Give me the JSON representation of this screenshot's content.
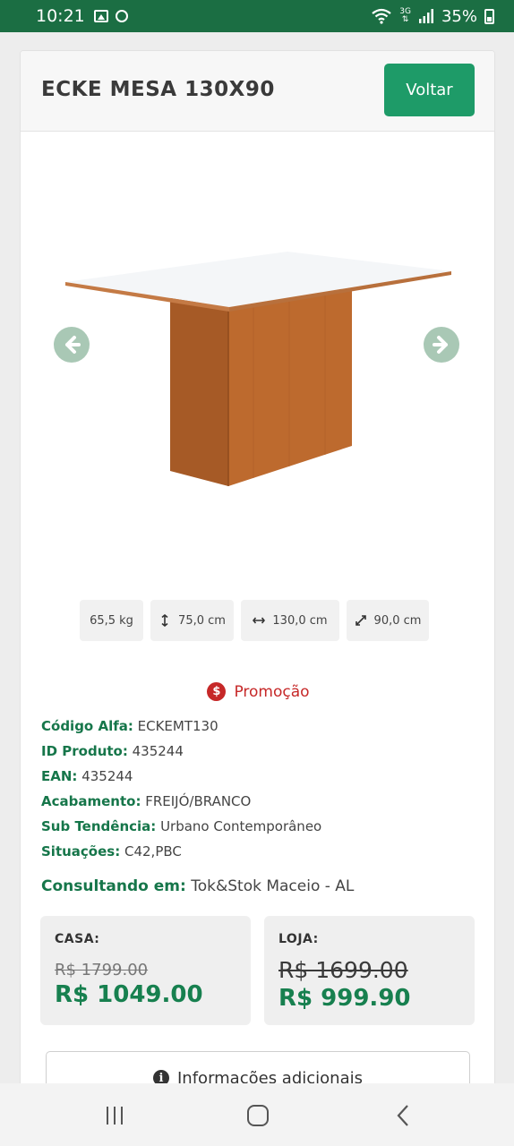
{
  "status_bar": {
    "time": "10:21",
    "network": "3G",
    "battery": "35%"
  },
  "header": {
    "title": "ECKE MESA 130X90",
    "back_button": "Voltar"
  },
  "dimensions": [
    {
      "icon": "weight",
      "value": "65,5 kg"
    },
    {
      "icon": "height-arrow-icon",
      "value": "75,0 cm"
    },
    {
      "icon": "width-arrow-icon",
      "value": "130,0 cm"
    },
    {
      "icon": "depth-arrow-icon",
      "value": "90,0 cm"
    }
  ],
  "promo": {
    "icon_symbol": "$",
    "label": "Promoção"
  },
  "specs": [
    {
      "label": "Código Alfa:",
      "value": "ECKEMT130"
    },
    {
      "label": "ID Produto:",
      "value": "435244"
    },
    {
      "label": "EAN:",
      "value": "435244"
    },
    {
      "label": "Acabamento:",
      "value": "FREIJÓ/BRANCO"
    },
    {
      "label": "Sub Tendência:",
      "value": "Urbano Contemporâneo"
    },
    {
      "label": "Situações:",
      "value": "C42,PBC"
    }
  ],
  "location": {
    "label": "Consultando em:",
    "value": "Tok&Stok Maceio - AL"
  },
  "prices": {
    "casa": {
      "label": "CASA:",
      "old": "R$ 1799.00",
      "new": "R$ 1049.00"
    },
    "loja": {
      "label": "LOJA:",
      "old": "R$ 1699.00",
      "new": "R$ 999.90"
    }
  },
  "info_button": {
    "icon_symbol": "i",
    "label": "Informações adicionais"
  },
  "colors": {
    "status_bar": "#1b6e43",
    "accent_green": "#1e9b68",
    "label_green": "#16764a",
    "price_green": "#17804f",
    "promo_red": "#c62828",
    "arrow_gray_green": "#a9c8b5"
  }
}
